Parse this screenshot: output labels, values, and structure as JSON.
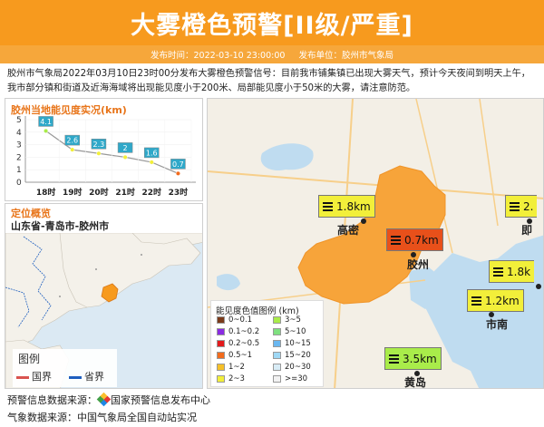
{
  "header": {
    "title": "大雾橙色预警[II级/严重]",
    "time_label": "发布时间：2022-03-10 23:00:00",
    "unit_label": "发布单位：胶州市气象局"
  },
  "description": "胶州市气象局2022年03月10日23时00分发布大雾橙色预警信号：目前我市铺集镇已出现大雾天气，预计今天夜间到明天上午，我市部分镇和街道及近海海域将出现能见度小于200米、局部能见度小于50米的大雾，请注意防范。",
  "chart_data": {
    "type": "line",
    "title": "胶州当地能见度实况(km)",
    "categories": [
      "18时",
      "19时",
      "20时",
      "21时",
      "22时",
      "23时"
    ],
    "values": [
      4.1,
      2.6,
      2.3,
      2,
      1.6,
      0.7
    ],
    "ylim": [
      0,
      5
    ],
    "yticks": [
      "0",
      "1",
      "2",
      "3",
      "4",
      "5"
    ],
    "point_labels": [
      "4.1",
      "2.6",
      "2.3",
      "2",
      "1.6",
      "0.7"
    ],
    "colors": {
      "label_fill": "#2fa8c9",
      "line": "#999999"
    }
  },
  "location": {
    "title": "定位概览",
    "path": "山东省-青岛市-胶州市",
    "legend_title": "图例",
    "legend_items": [
      {
        "label": "国界",
        "color": "#d9534f"
      },
      {
        "label": "省界",
        "color": "#1e5fbf"
      }
    ]
  },
  "map": {
    "labels": [
      {
        "text": "1.8km",
        "color": "#f2ef3a"
      },
      {
        "text": "0.7km",
        "color": "#e8501a"
      },
      {
        "text": "1.2km",
        "color": "#f2ef3a"
      },
      {
        "text": "3.5km",
        "color": "#a9ec4a"
      },
      {
        "text": "2.",
        "color": "#f2ef3a"
      },
      {
        "text": "1.8k",
        "color": "#f2ef3a"
      }
    ],
    "cities": [
      "高密",
      "胶州",
      "市南",
      "黄岛",
      "即"
    ],
    "legend": {
      "title": "能见度色值图例 (km)",
      "items": [
        {
          "label": "0~0.1",
          "color": "#7b3a1a"
        },
        {
          "label": "3~5",
          "color": "#a9ec4a"
        },
        {
          "label": "0.1~0.2",
          "color": "#8a2be2"
        },
        {
          "label": "5~10",
          "color": "#7fe07f"
        },
        {
          "label": "0.2~0.5",
          "color": "#e31a1c"
        },
        {
          "label": "10~15",
          "color": "#6ab7f0"
        },
        {
          "label": "0.5~1",
          "color": "#f26b1d"
        },
        {
          "label": "15~20",
          "color": "#9fd8f5"
        },
        {
          "label": "1~2",
          "color": "#f6c028"
        },
        {
          "label": "20~30",
          "color": "#d8ecf6"
        },
        {
          "label": "2~3",
          "color": "#f2ef3a"
        },
        {
          "label": ">=30",
          "color": "#f2f2f2"
        }
      ]
    }
  },
  "footer": {
    "warning_source_prefix": "预警信息数据来源：",
    "warning_source": "国家预警信息发布中心",
    "weather_source": "气象数据来源：中国气象局全国自动站实况"
  }
}
